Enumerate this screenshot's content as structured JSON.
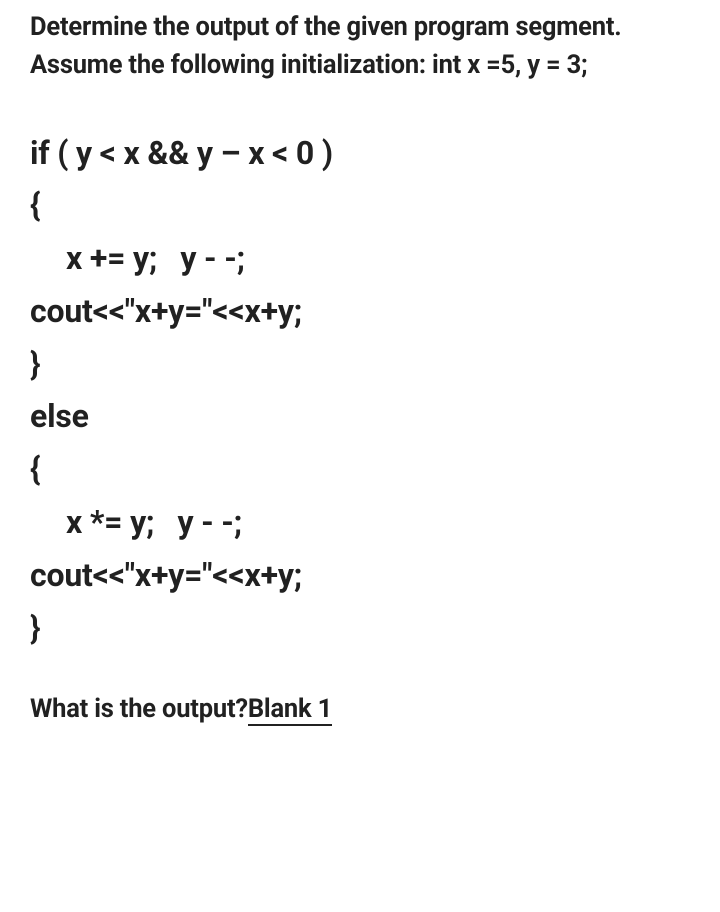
{
  "intro": "Determine the output of the given program segment. Assume the following initialization: int x =5, y = 3;",
  "code": {
    "line1": "if ( y < x && y – x < 0 )",
    "line2": "{",
    "line3": "x += y;   y - -;",
    "line4": "cout<<\"x+y=\"<<x+y;",
    "line5": "}",
    "line6": "else",
    "line7": "{",
    "line8": "x *= y;   y - -;",
    "line9": "cout<<\"x+y=\"<<x+y;",
    "line10": "}"
  },
  "question": "What is the output?",
  "blank_label": "Blank 1"
}
